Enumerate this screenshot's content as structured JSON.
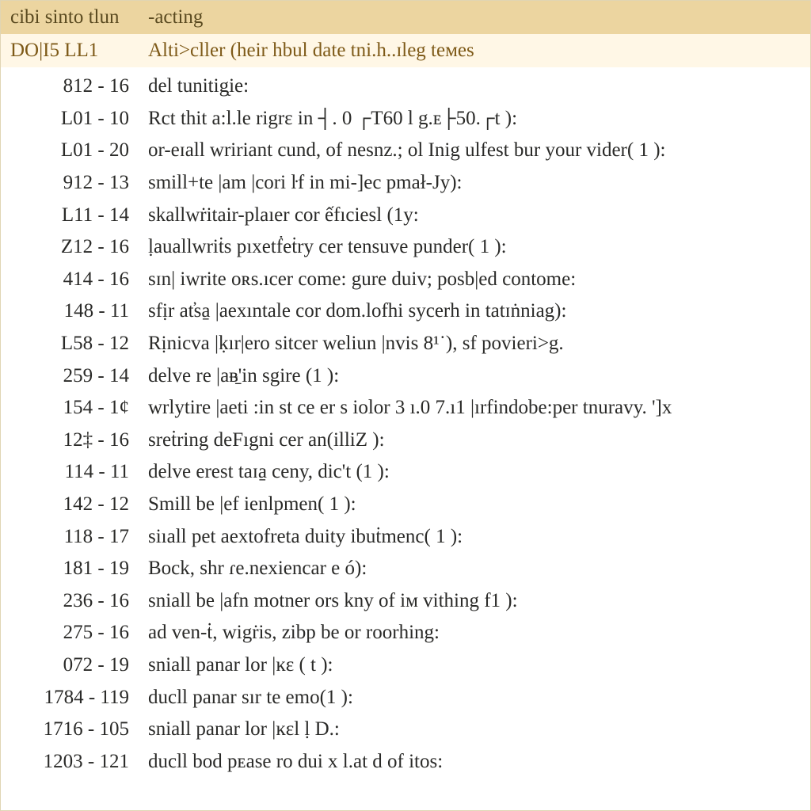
{
  "header1": {
    "code": "cibi sinto tlun",
    "desc": "-acting"
  },
  "header2": {
    "code": "DO|I5 LL1",
    "desc": "Alti>cller (heir hbul date tni.h..ɪleg teᴍes"
  },
  "rows": [
    {
      "code": "812 - 16",
      "desc": "del tunitig̨ie:"
    },
    {
      "code": "L01 - 10",
      "desc": "Rct thit a:l.le rigrɛ in ┤. 0 ┌T60 l g.ᴇ├50.┌t ):"
    },
    {
      "code": "L01 - 20",
      "desc": "or-eɪall wririant cund, of nesnz.; ol Inig ulfest bur your vider( 1 ):"
    },
    {
      "code": "912 - 13",
      "desc": "smill+te |am |cori ŀf in mi-]ec pmał-Jy):"
    },
    {
      "code": "L11 - 14",
      "desc": "skallwṙitair-plaıer cor ếfıciesl   (1y:"
    },
    {
      "code": "Z12 - 16",
      "desc": "ḷauallwriṫs pıxetḟeṫry cer tensuve punder( 1 ):"
    },
    {
      "code": "414 - 16",
      "desc": "sɪn| iwrite oʀs.ıcer come: gure duiv; posb|ed contome:"
    },
    {
      "code": "148 - 11",
      "desc": "sfịr at̕sa̱ |aexıntale cor dom.lofhi sycerh in tatɪṅniag):"
    },
    {
      "code": "L58 - 12",
      "desc": "Rịnicva |ḳır|ero sitcer weliun |nvis 8¹˙), sf povieri>g."
    },
    {
      "code": "259 - 14",
      "desc": "delve re |aᴃ̱'in sgire (1 ):"
    },
    {
      "code": "154 - 1ȼ",
      "desc": "wrlytire |aeti :in st ce er s iolor 3 ı.0 7.ı1 |ırfindobe:per tnuravy. ']x"
    },
    {
      "code": "12‡ - 16",
      "desc": "sreṫring deFıgni cer an(illiZ ):"
    },
    {
      "code": "114 - 11",
      "desc": "delve erest taɪa̱ ceny, dic't (1 ):"
    },
    {
      "code": "142 - 12",
      "desc": "Smill be |ef ienlpmen( 1 ):"
    },
    {
      "code": "118 - 17",
      "desc": "siıall pet aextofreta duity ibuṫmenc( 1 ):"
    },
    {
      "code": "181 - 19",
      "desc": "Bock, shr ɾe.nexiencar e ó):"
    },
    {
      "code": "236 - 16",
      "desc": "sniall be |afn motner ors kny of iᴍ vithing f1 ):"
    },
    {
      "code": "275 - 16",
      "desc": "ad ven-ṫ, wigṙis, zibp be or roorhing:"
    },
    {
      "code": "072 - 19",
      "desc": "sniall panar lor |ĸɛ ( t ):"
    },
    {
      "code": "1784 - 119",
      "desc": "ducll panar sır te emo(1 ):"
    },
    {
      "code": "1716 - 105",
      "desc": "sniall panar lor |ĸɛl ḷ D.:"
    },
    {
      "code": "1203 - 121",
      "desc": "ducll bod pᴇase ro dui x l.at d of itos:"
    }
  ]
}
